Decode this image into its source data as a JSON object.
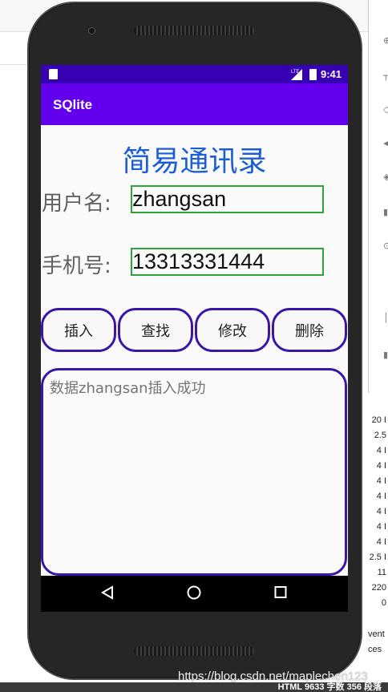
{
  "status_bar": {
    "network": "LTE",
    "time": "9:41"
  },
  "app_bar": {
    "title": "SQlite"
  },
  "main": {
    "heading": "简易通讯录",
    "username_label": "用户名:",
    "username_value": "zhangsan",
    "phone_label": "手机号:",
    "phone_value": "13313331444",
    "buttons": {
      "insert": "插入",
      "query": "查找",
      "update": "修改",
      "delete": "删除"
    },
    "output_text": "数据zhangsan插入成功"
  },
  "nav_bar": {
    "back_icon": "back-triangle-icon",
    "home_icon": "home-circle-icon",
    "recents_icon": "recents-square-icon"
  },
  "background": {
    "side_values": [
      "20 I",
      "2.5",
      "4 I",
      "4 I",
      "4 I",
      "4 I",
      "4 I",
      "4 I",
      "4 I",
      "2.5 I",
      "11",
      "220",
      "0"
    ],
    "side_misc": [
      "vent",
      "ces"
    ]
  },
  "watermark": "https://blog.csdn.net/maplechen123",
  "footer": "HTML  9633 字数  356 段落",
  "colors": {
    "status_bar": "#3700b3",
    "app_bar": "#6200ee",
    "heading": "#1c5fd4",
    "field_border": "#2ea43a",
    "button_border": "#3915a8"
  }
}
